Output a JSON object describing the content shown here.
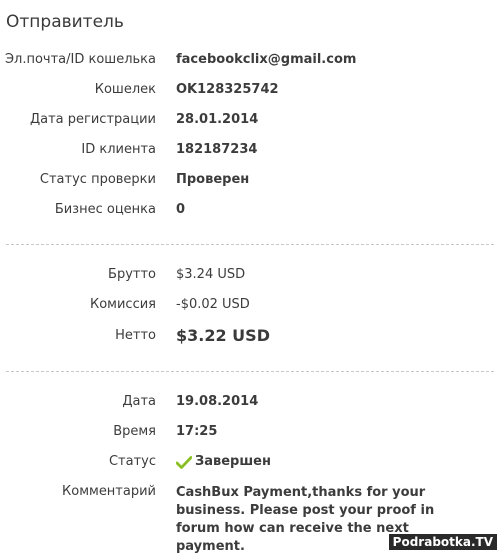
{
  "sender": {
    "title": "Отправитель",
    "fields": [
      {
        "label": "Эл.почта/ID кошелька",
        "value": "facebookclix@gmail.com"
      },
      {
        "label": "Кошелек",
        "value": "OK128325742"
      },
      {
        "label": "Дата регистрации",
        "value": "28.01.2014"
      },
      {
        "label": "ID клиента",
        "value": "182187234"
      },
      {
        "label": "Статус проверки",
        "value": "Проверен"
      },
      {
        "label": "Бизнес оценка",
        "value": "0"
      }
    ]
  },
  "amounts": {
    "gross_label": "Брутто",
    "gross_value": "$3.24 USD",
    "fee_label": "Комиссия",
    "fee_value": "-$0.02 USD",
    "net_label": "Нетто",
    "net_value": "$3.22 USD"
  },
  "details": {
    "date_label": "Дата",
    "date_value": "19.08.2014",
    "time_label": "Время",
    "time_value": "17:25",
    "status_label": "Статус",
    "status_value": "Завершен",
    "status_icon": "check-icon",
    "comment_label": "Комментарий",
    "comment_value": "CashBux Payment,thanks for your business. Please post your proof in forum how can receive the next payment."
  },
  "watermark": "Podrabotka.TV",
  "colors": {
    "check": "#9acd32",
    "text": "#3c3c3c",
    "divider": "#c8c8c8"
  }
}
